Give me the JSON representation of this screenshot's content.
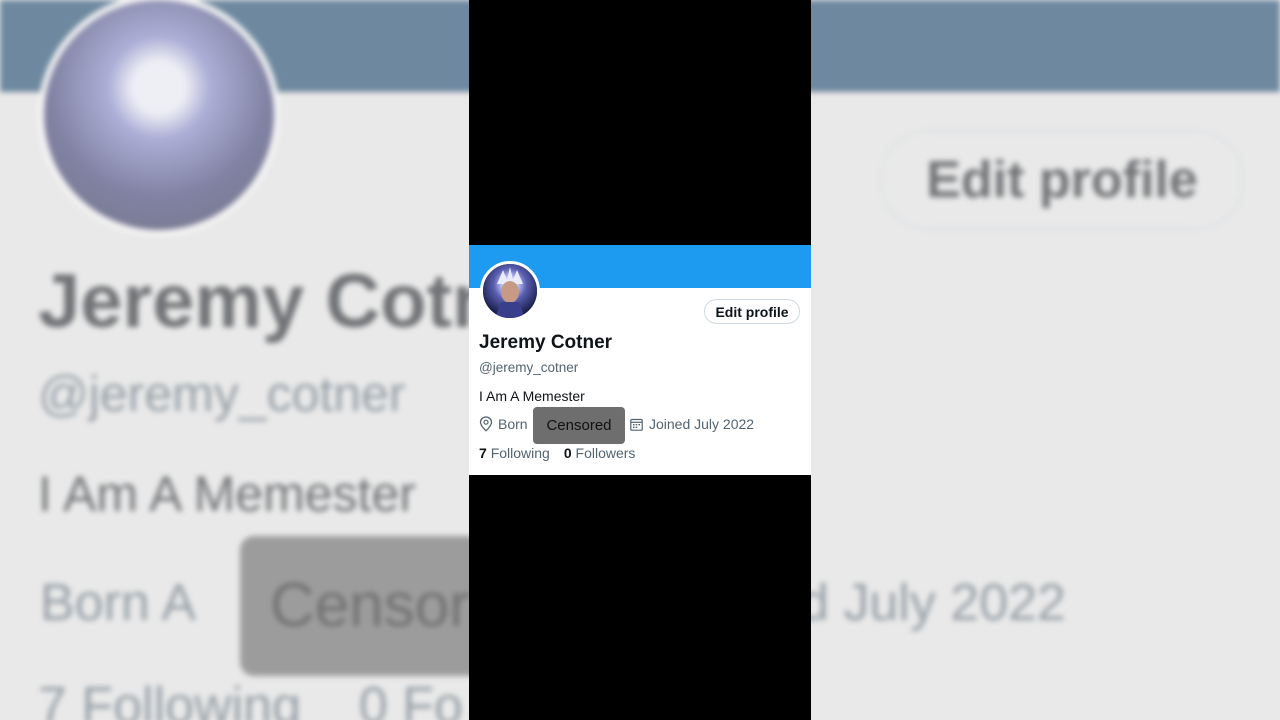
{
  "profile": {
    "name": "Jeremy Cotner",
    "handle": "@jeremy_cotner",
    "bio": "I Am A Memester",
    "born_prefix": "Born",
    "censored_label": "Censored",
    "joined": "Joined July 2022",
    "following_count": "7",
    "following_label": "Following",
    "followers_count": "0",
    "followers_label": "Followers",
    "edit_button": "Edit profile"
  },
  "background": {
    "name_fragment": "Jeremy Cotn",
    "handle": "@jeremy_cotner",
    "bio_fragment": "I Am A Memester",
    "born_fragment": "Born A",
    "censored_fragment": "Censor",
    "joined_fragment": "d July 2022",
    "following_fragment": "7 Following",
    "followers_fragment": "0 Fo",
    "edit_button": "Edit profile"
  },
  "icons": {
    "location": "location-pin-icon",
    "calendar": "calendar-icon"
  },
  "colors": {
    "banner": "#1d9bf0",
    "text_primary": "#0f1419",
    "text_secondary": "#536471",
    "censor_box": "#6e6e6e"
  }
}
